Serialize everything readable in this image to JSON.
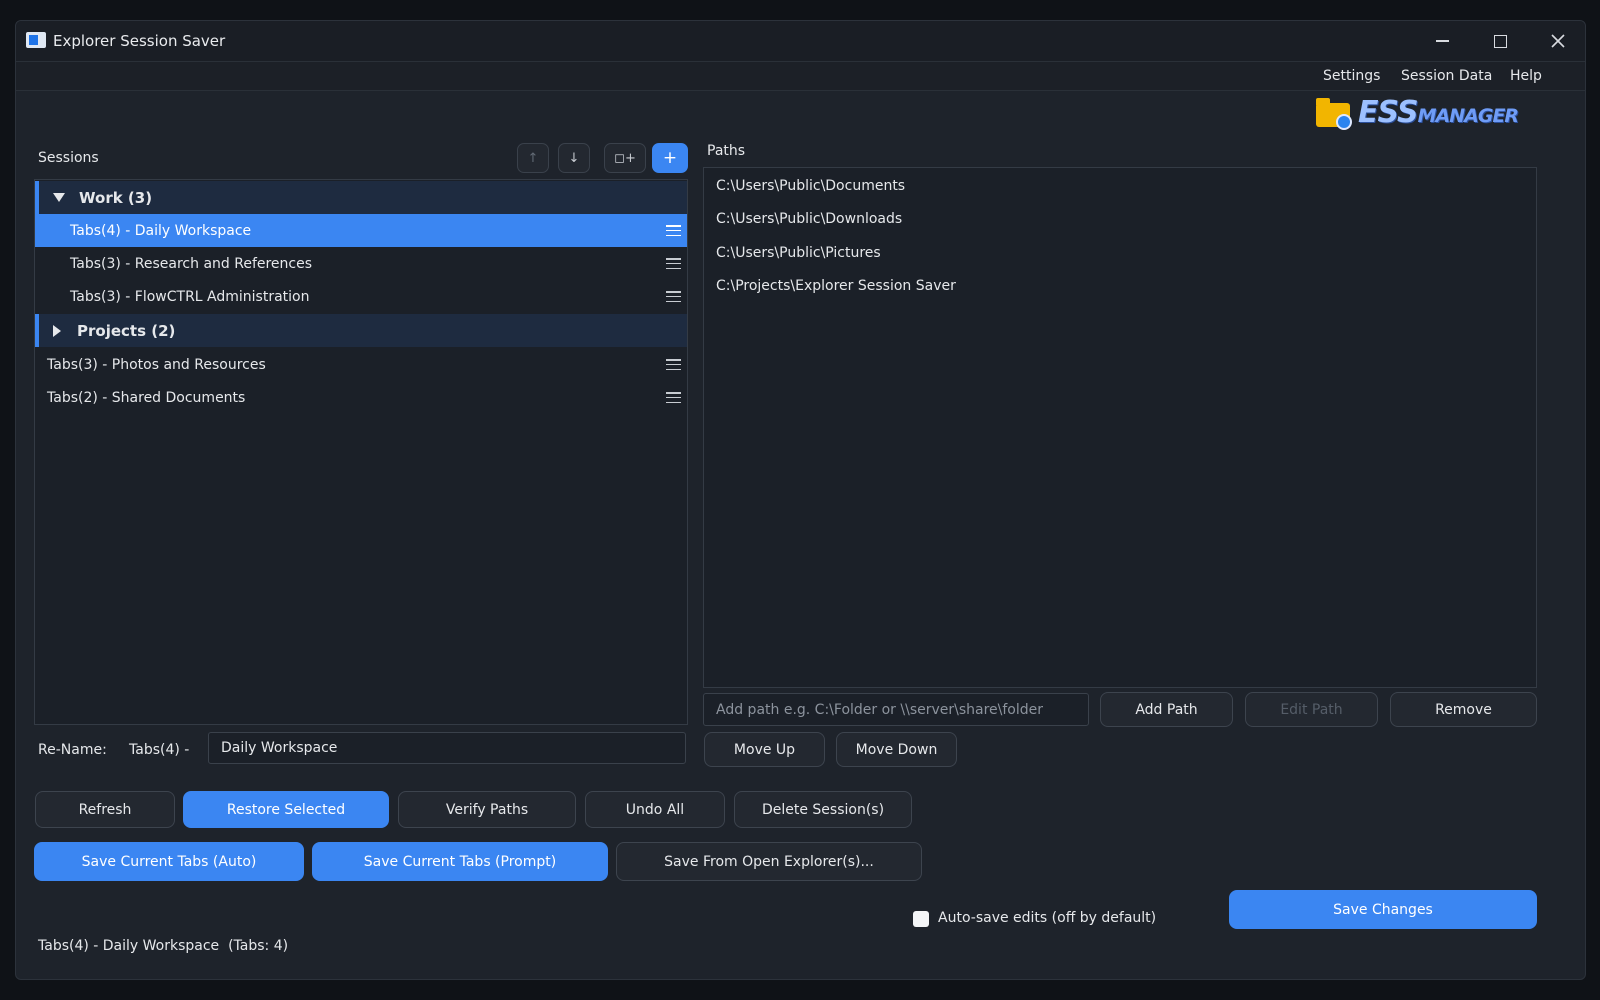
{
  "window": {
    "title": "Explorer Session Saver"
  },
  "menu": {
    "items": [
      "Settings",
      "Session Data",
      "Help"
    ]
  },
  "logo": {
    "big": "ESS",
    "small": "MANAGER"
  },
  "sessions": {
    "label": "Sessions",
    "toolbar": {
      "up": "↑",
      "down": "↓",
      "add_group": "◻+",
      "add": "+"
    },
    "rows": [
      {
        "label": "Work (3)"
      },
      {
        "label": "Tabs(4) - Daily Workspace"
      },
      {
        "label": "Tabs(3) - Research and References"
      },
      {
        "label": "Tabs(3) - FlowCTRL Administration"
      },
      {
        "label": "Projects (2)"
      },
      {
        "label": "Tabs(3) - Photos and Resources"
      },
      {
        "label": "Tabs(2) - Shared Documents"
      }
    ]
  },
  "paths": {
    "label": "Paths",
    "items": [
      "C:\\Users\\Public\\Documents",
      "C:\\Users\\Public\\Downloads",
      "C:\\Users\\Public\\Pictures",
      "C:\\Projects\\Explorer Session Saver"
    ],
    "input_placeholder": "Add path e.g. C:\\Folder or \\\\server\\share\\folder",
    "add_label": "Add Path",
    "edit_label": "Edit Path",
    "remove_label": "Remove",
    "move_up_label": "Move Up",
    "move_down_label": "Move Down"
  },
  "rename": {
    "label": "Re-Name:",
    "prefix": "Tabs(4) -",
    "value": "Daily Workspace"
  },
  "actions": {
    "refresh": "Refresh",
    "restore": "Restore Selected",
    "verify": "Verify Paths",
    "undo": "Undo All",
    "delete": "Delete Session(s)",
    "save_auto": "Save Current Tabs (Auto)",
    "save_prompt": "Save Current Tabs (Prompt)",
    "save_explorer": "Save From Open Explorer(s)...",
    "save_changes": "Save Changes"
  },
  "autosave": {
    "label": "Auto-save edits (off by default)"
  },
  "status": {
    "text": "Tabs(4) - Daily Workspace  (Tabs: 4)"
  },
  "colors": {
    "accent": "#3b86f2",
    "background": "#1e232b"
  }
}
